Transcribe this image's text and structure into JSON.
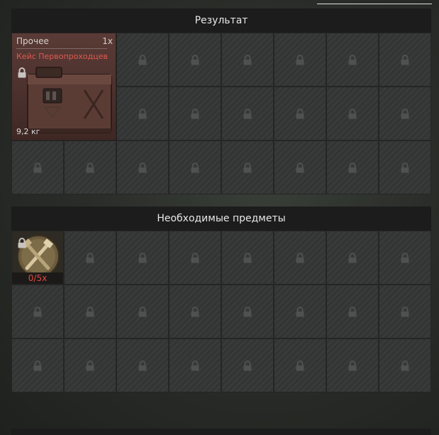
{
  "result_section": {
    "title": "Результат",
    "item": {
      "category": "Прочее",
      "count": "1x",
      "name": "Кейс Первопроходцев",
      "weight": "9,2 кг"
    }
  },
  "required_section": {
    "title": "Необходимые предметы",
    "item": {
      "progress": "0/5x"
    }
  },
  "icons": {
    "lock": "lock-icon",
    "result_item": "case-icon",
    "required_item": "crossed-tools-icon"
  },
  "colors": {
    "item_name": "#e05a50",
    "progress": "#e04a40",
    "item_background": "#4a302c"
  }
}
